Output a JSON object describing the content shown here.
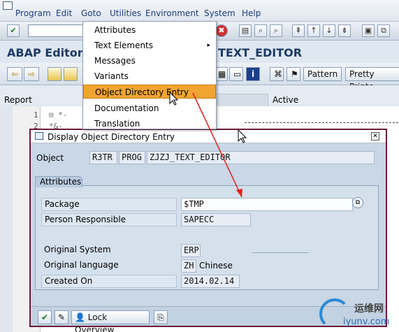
{
  "menubar": {
    "items": [
      "Program",
      "Edit",
      "Goto",
      "Utilities",
      "Environment",
      "System",
      "Help"
    ]
  },
  "title": {
    "left": "ABAP Editor:",
    "right": "TEXT_EDITOR"
  },
  "app_toolbar": {
    "pattern_label": "Pattern",
    "pretty_printer_label": "Pretty Printe"
  },
  "report_row": {
    "label": "Report",
    "status": "Active"
  },
  "editor": {
    "line_numbers": [
      "1",
      "2"
    ],
    "lines": [
      "⊟ *-",
      "   *&-"
    ]
  },
  "goto_menu": {
    "items": [
      {
        "label": "Attributes",
        "submenu": false
      },
      {
        "label": "Text Elements",
        "submenu": true
      },
      {
        "label": "Messages",
        "submenu": false
      },
      {
        "label": "Variants",
        "submenu": false
      },
      {
        "label": "Object Directory Entry",
        "submenu": false,
        "highlighted": true
      },
      {
        "label": "Documentation",
        "submenu": false
      },
      {
        "label": "Translation",
        "submenu": false
      }
    ]
  },
  "dialog": {
    "title": "Display Object Directory Entry",
    "object_label": "Object",
    "object_values": [
      "R3TR",
      "PROG",
      "ZJZJ_TEXT_EDITOR"
    ],
    "attributes_tab": "Attributes",
    "fields": {
      "package_label": "Package",
      "package_value": "$TMP",
      "person_label": "Person Responsible",
      "person_value": "SAPECC",
      "original_system_label": "Original System",
      "original_system_value": "ERP",
      "original_language_label": "Original language",
      "original_language_value": "ZH",
      "original_language_text": "Chinese",
      "created_on_label": "Created On",
      "created_on_value": "2014.02.14"
    },
    "footer": {
      "lock_overview_label": "Lock Overview"
    }
  },
  "watermark": {
    "line1": "运维网",
    "line2": "iyunv.com"
  },
  "colors": {
    "highlight": "#f1a531",
    "dialog_border": "#6b1a3a",
    "annotation_arrow": "#e02020"
  }
}
